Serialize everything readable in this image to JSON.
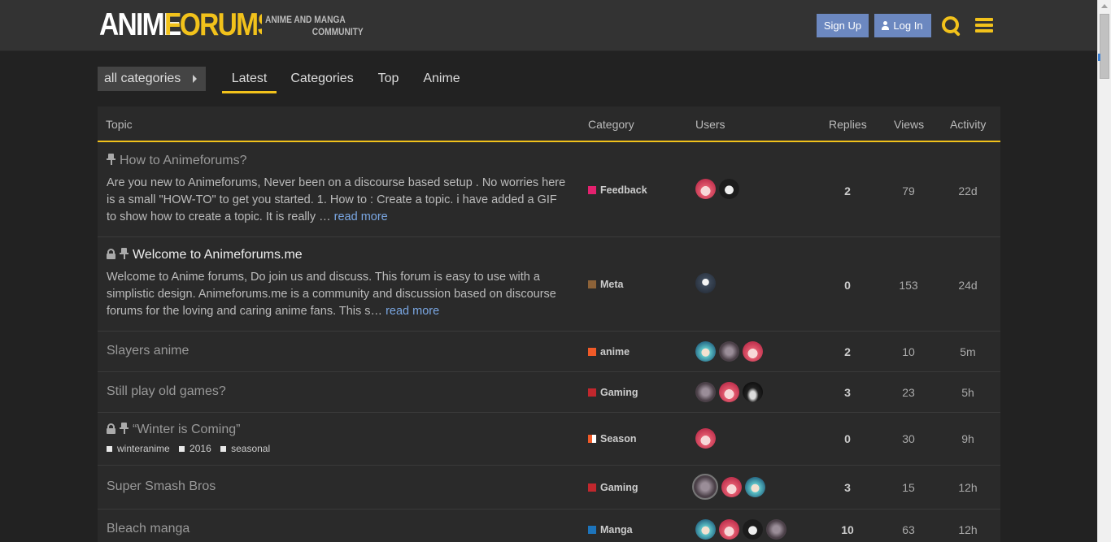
{
  "header": {
    "logo_part1": "ANIME",
    "logo_part2": "FORUMS",
    "tagline_line1": "ANIME AND MANGA",
    "tagline_line2": "COMMUNITY",
    "signup_label": "Sign Up",
    "login_label": "Log In"
  },
  "nav": {
    "category_dropdown": "all categories",
    "tabs": [
      {
        "label": "Latest",
        "active": true
      },
      {
        "label": "Categories",
        "active": false
      },
      {
        "label": "Top",
        "active": false
      },
      {
        "label": "Anime",
        "active": false
      }
    ]
  },
  "table": {
    "headers": {
      "topic": "Topic",
      "category": "Category",
      "users": "Users",
      "replies": "Replies",
      "views": "Views",
      "activity": "Activity"
    },
    "rows": [
      {
        "title": "How to Animeforums?",
        "excerpt": "Are you new to Animeforums, Never been on a discourse based setup . No worries here is a small \"HOW-TO\" to get you started. 1. How to : Create a topic. i have added a GIF to show how to create a topic. It is really …",
        "read_more": "read more",
        "category": "Feedback",
        "replies": "2",
        "views": "79",
        "activity": "22d"
      },
      {
        "title": "Welcome to Animeforums.me",
        "excerpt": "Welcome to Anime forums, Do join us and discuss. This forum is easy to use with a simplistic design. Animeforums.me is a community and discussion based on discourse forums for the loving and caring anime fans. This s…",
        "read_more": "read more",
        "category": "Meta",
        "replies": "0",
        "views": "153",
        "activity": "24d"
      },
      {
        "title": "Slayers anime",
        "category": "anime",
        "replies": "2",
        "views": "10",
        "activity": "5m"
      },
      {
        "title": "Still play old games?",
        "category": "Gaming",
        "replies": "3",
        "views": "23",
        "activity": "5h"
      },
      {
        "title": "“Winter is Coming”",
        "tags": [
          "winteranime",
          "2016",
          "seasonal"
        ],
        "category": "Season",
        "replies": "0",
        "views": "30",
        "activity": "9h"
      },
      {
        "title": "Super Smash Bros",
        "category": "Gaming",
        "replies": "3",
        "views": "15",
        "activity": "12h"
      },
      {
        "title": "Bleach manga",
        "category": "Manga",
        "replies": "10",
        "views": "63",
        "activity": "12h"
      }
    ]
  },
  "colors": {
    "accent": "#f2c21b",
    "button": "#6c88c0",
    "cat_feedback": "#e3216e",
    "cat_meta": "#8c6238",
    "cat_anime": "#f05a28",
    "cat_gaming": "#c1272d",
    "cat_manga": "#1d74bb"
  }
}
